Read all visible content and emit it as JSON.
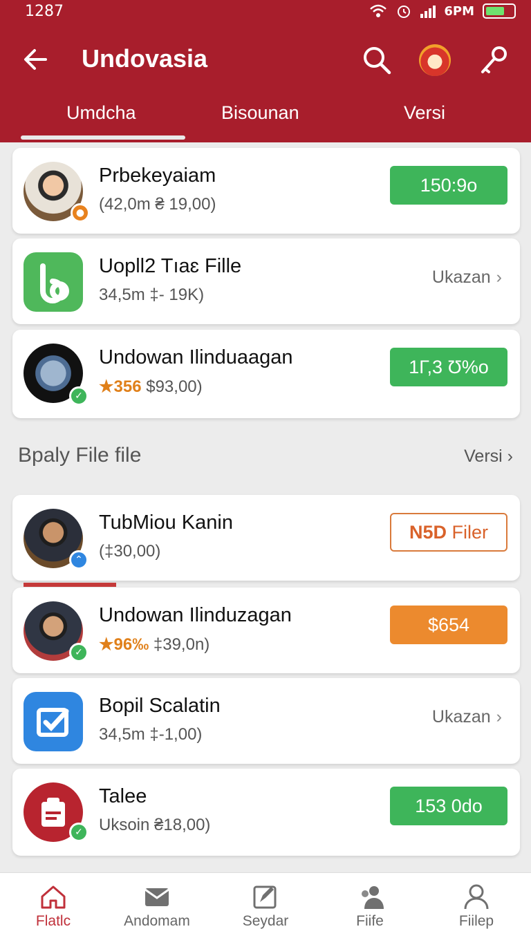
{
  "status_bar": {
    "time": "1287",
    "network": "6PM"
  },
  "header": {
    "title": "Undovasia",
    "icons": [
      "back-arrow-icon",
      "search-icon",
      "avatar",
      "key-icon"
    ]
  },
  "tabs": [
    {
      "label": "Umdcha",
      "active": true
    },
    {
      "label": "Bisounan",
      "active": false
    },
    {
      "label": "Versi",
      "active": false
    }
  ],
  "list_top": [
    {
      "name": "Prbekeyaiam",
      "sub": "(42,0m ₴ 19,00)",
      "action": {
        "type": "green",
        "label": "150:9о"
      }
    },
    {
      "name": "Uopll2 Tıaɛ Fille",
      "sub": "34,5m ‡- 19K)",
      "action": {
        "type": "link",
        "label": "Ukazan"
      }
    },
    {
      "name": "Undowan Ilinduaagan",
      "rating": "★356",
      "sub": "$93,00)",
      "action": {
        "type": "green",
        "label": "1Г,3 Ʊ%о"
      }
    }
  ],
  "section": {
    "title": "Bpaly File file",
    "link": "Versi"
  },
  "list_bottom": [
    {
      "name": "TubMiou Kanin",
      "sub": "(‡30,00)",
      "action": {
        "type": "outline",
        "label_bold": "N5D",
        "label": "Filer"
      }
    },
    {
      "name": "Undowan Ilinduzagan",
      "rating": "★96‰",
      "sub": "‡39,0n)",
      "action": {
        "type": "orange",
        "label": "$654"
      }
    },
    {
      "name": "Bopil Scalatin",
      "sub": "34,5m ‡-1,00)",
      "action": {
        "type": "link",
        "label": "Ukazan"
      }
    },
    {
      "name": "Talee",
      "sub": "Uksoin ₴18,00)",
      "action": {
        "type": "green",
        "label": "153 0dо"
      }
    }
  ],
  "bottom_nav": [
    {
      "label": "Flatlc",
      "icon": "home-icon",
      "active": true
    },
    {
      "label": "Andomam",
      "icon": "mail-icon",
      "active": false
    },
    {
      "label": "Seydar",
      "icon": "edit-icon",
      "active": false
    },
    {
      "label": "Fiife",
      "icon": "people-icon",
      "active": false
    },
    {
      "label": "Fiilep",
      "icon": "person-icon",
      "active": false
    }
  ],
  "colors": {
    "brand": "#a81e2c",
    "green": "#3eb55a",
    "orange": "#ec8a2e",
    "rating": "#e0801a"
  }
}
